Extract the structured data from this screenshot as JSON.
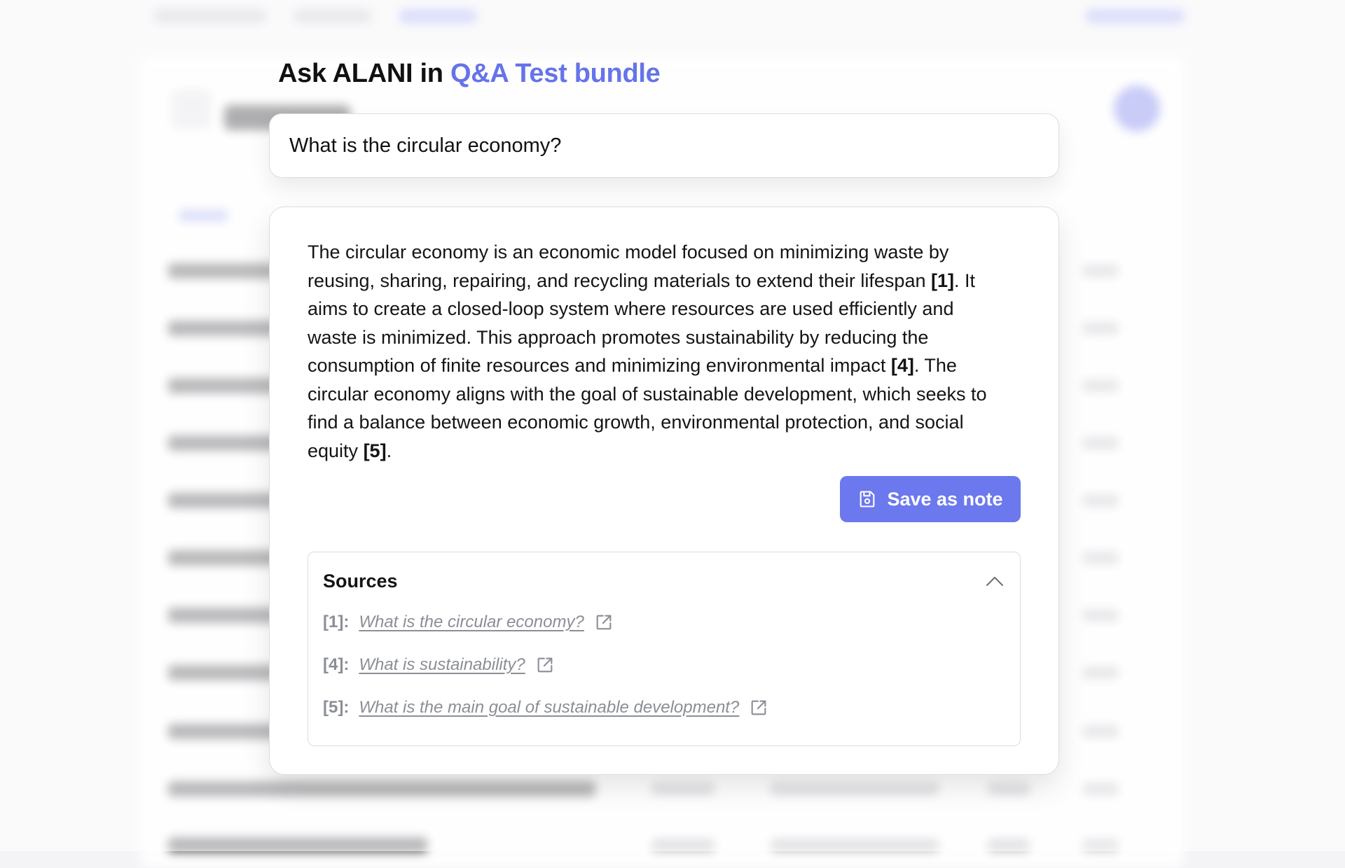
{
  "dialog": {
    "heading_prefix": "Ask ALANI in",
    "bundle_name": "Q&A Test bundle"
  },
  "question": {
    "value": "What is the circular economy?"
  },
  "answer": {
    "part1": "The circular economy is an economic model focused on minimizing waste by reusing, sharing, repairing, and recycling materials to extend their lifespan ",
    "cite1": "[1]",
    "part2": ". It aims to create a closed-loop system where resources are used efficiently and waste is minimized. This approach promotes sustainability by reducing the consumption of finite resources and minimizing environmental impact ",
    "cite2": "[4]",
    "part3": ". The circular economy aligns with the goal of sustainable development, which seeks to find a balance between economic growth, environmental protection, and social equity ",
    "cite3": "[5]",
    "part4": "."
  },
  "actions": {
    "save_note_label": "Save as note"
  },
  "sources": {
    "title": "Sources",
    "items": [
      {
        "ref": "[1]:",
        "title": "What is the circular economy?"
      },
      {
        "ref": "[4]:",
        "title": "What is sustainability?"
      },
      {
        "ref": "[5]:",
        "title": "What is the main goal of sustainable development?"
      }
    ]
  },
  "colors": {
    "accent": "#6574e8",
    "button": "#6c78ed",
    "source_text": "#8b8e96"
  },
  "icons": {
    "save": "save-icon",
    "collapse": "chevron-up-icon",
    "external": "external-link-icon"
  }
}
